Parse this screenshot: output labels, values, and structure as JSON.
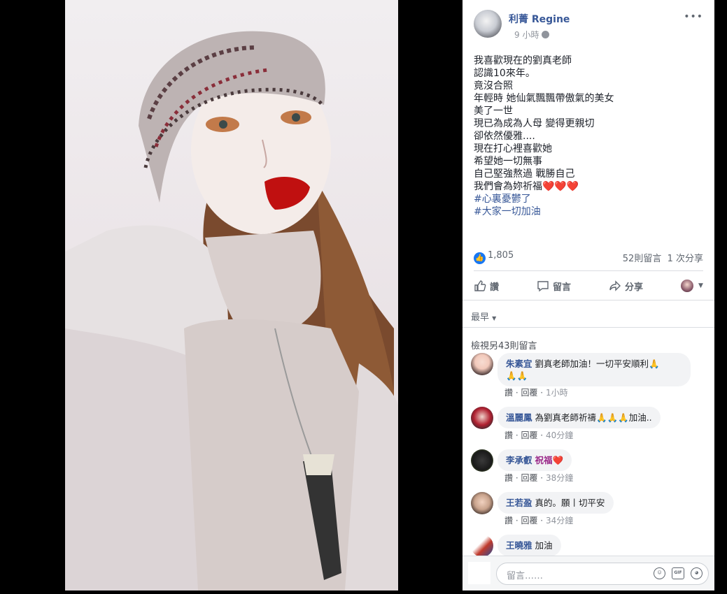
{
  "post": {
    "author": "利菁 Regine",
    "time": "9 小時",
    "more_label": "•••",
    "body_lines": [
      "我喜歡現在的劉真老師",
      "認識10來年。",
      "竟沒合照",
      "年輕時 她仙氣飄飄帶傲氣的美女",
      "美了一世",
      "現已為成為人母 變得更親切",
      "卻依然優雅....",
      "現在打心裡喜歡她",
      "希望她一切無事",
      "自己堅強熬過 戰勝自己"
    ],
    "last_line": "我們會為妳祈福",
    "last_line_hearts": "❤️❤️❤️",
    "hashtags": [
      "#心裏憂鬱了",
      "#大家一切加油"
    ],
    "like_count": "1,805",
    "comment_count": "52則留言",
    "share_count": "1 次分享"
  },
  "actions": {
    "like": "讚",
    "comment": "留言",
    "share": "分享"
  },
  "comments_section": {
    "sort_label": "最早",
    "view_more": "檢視另43則留言",
    "reply_label": "回覆",
    "like_label": "讚",
    "items": [
      {
        "name": "朱素宜",
        "text": "劉真老師加油！一切平安順利🙏",
        "text_line2": "🙏🙏",
        "time": "1小時"
      },
      {
        "name": "溫麗鳳",
        "text": "為劉真老師祈禱🙏🙏🙏加油..",
        "time": "40分鐘"
      },
      {
        "name": "李承叡",
        "text": "祝福❤️",
        "time": "38分鐘"
      },
      {
        "name": "王若盈",
        "text": "真的。願丨切平安",
        "time": "34分鐘"
      },
      {
        "name": "王曉雅",
        "text": "加油"
      }
    ]
  },
  "composer": {
    "placeholder": "留言……",
    "icons": [
      "emoji-icon",
      "gif-icon",
      "sticker-icon"
    ]
  },
  "colors": {
    "link": "#385898",
    "brand_blue": "#1877f2",
    "bubble": "#f2f3f5"
  }
}
